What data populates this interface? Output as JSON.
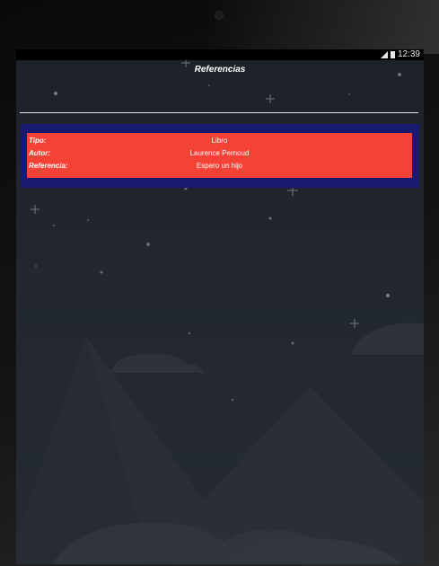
{
  "status_bar": {
    "time": "12:39",
    "icons": [
      "signal-icon",
      "battery-icon"
    ]
  },
  "header": {
    "title": "Referencias"
  },
  "reference": {
    "rows": [
      {
        "label": "Tipo:",
        "value": "Libro"
      },
      {
        "label": "Autor:",
        "value": "Laurence Pernoud"
      },
      {
        "label": "Referencia:",
        "value": "Espero un hijo"
      }
    ]
  },
  "colors": {
    "card_border": "#191970",
    "card_fill": "#f44336",
    "background_top": "#1d2129",
    "background_bottom": "#262b33"
  }
}
